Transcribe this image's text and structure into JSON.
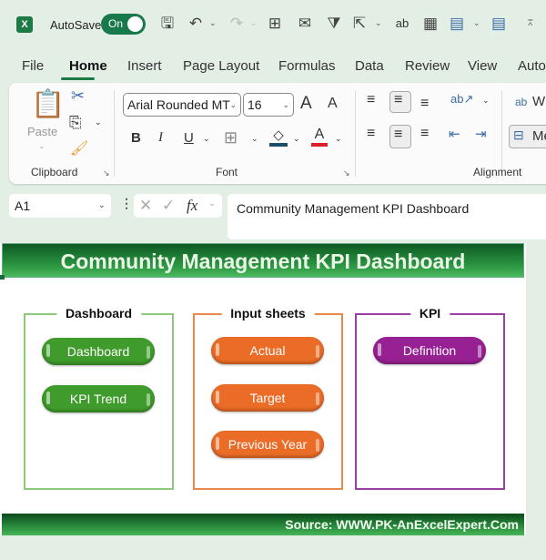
{
  "quick_access": {
    "app_icon": "excel-logo-icon",
    "app_letter": "X",
    "autosave_label": "AutoSave",
    "autosave_state": "On",
    "icons": [
      "save-sync-icon",
      "undo-icon",
      "redo-icon",
      "borders-icon",
      "email-attach-icon",
      "filter-icon",
      "share-icon",
      "spelling-icon",
      "table-icon",
      "calculator-icon",
      "calculator-icon",
      "customize-icon"
    ]
  },
  "tabs": [
    {
      "label": "File"
    },
    {
      "label": "Home",
      "active": true
    },
    {
      "label": "Insert"
    },
    {
      "label": "Page Layout"
    },
    {
      "label": "Formulas"
    },
    {
      "label": "Data"
    },
    {
      "label": "Review"
    },
    {
      "label": "View"
    },
    {
      "label": "Auto"
    }
  ],
  "ribbon": {
    "clipboard": {
      "label": "Clipboard",
      "paste": "Paste"
    },
    "font": {
      "label": "Font",
      "family": "Arial Rounded MT",
      "size": "16",
      "bold": "B",
      "italic": "I",
      "underline": "U",
      "grow": "A",
      "shrink": "A",
      "font_color": "A"
    },
    "alignment": {
      "label": "Alignment",
      "wrap": "W",
      "merge": "Me"
    }
  },
  "formula_bar": {
    "name_box": "A1",
    "cancel": "✕",
    "enter": "✓",
    "fx": "fx",
    "content": "Community Management KPI Dashboard"
  },
  "sheet": {
    "title": "Community Management KPI Dashboard",
    "footer": "Source: WWW.PK-AnExcelExpert.Com",
    "sections": [
      {
        "title": "Dashboard",
        "color": "#8cc97a",
        "buttons": [
          {
            "label": "Dashboard",
            "color": "#3f9b2b"
          },
          {
            "label": "KPI Trend",
            "color": "#3f9b2b"
          }
        ]
      },
      {
        "title": "Input sheets",
        "color": "#e8884a",
        "buttons": [
          {
            "label": "Actual",
            "color": "#ea6c27"
          },
          {
            "label": "Target",
            "color": "#ea6c27"
          },
          {
            "label": "Previous Year",
            "color": "#ea6c27"
          }
        ]
      },
      {
        "title": "KPI",
        "color": "#9b3ea2",
        "buttons": [
          {
            "label": "Definition",
            "color": "#972193"
          }
        ]
      }
    ]
  }
}
